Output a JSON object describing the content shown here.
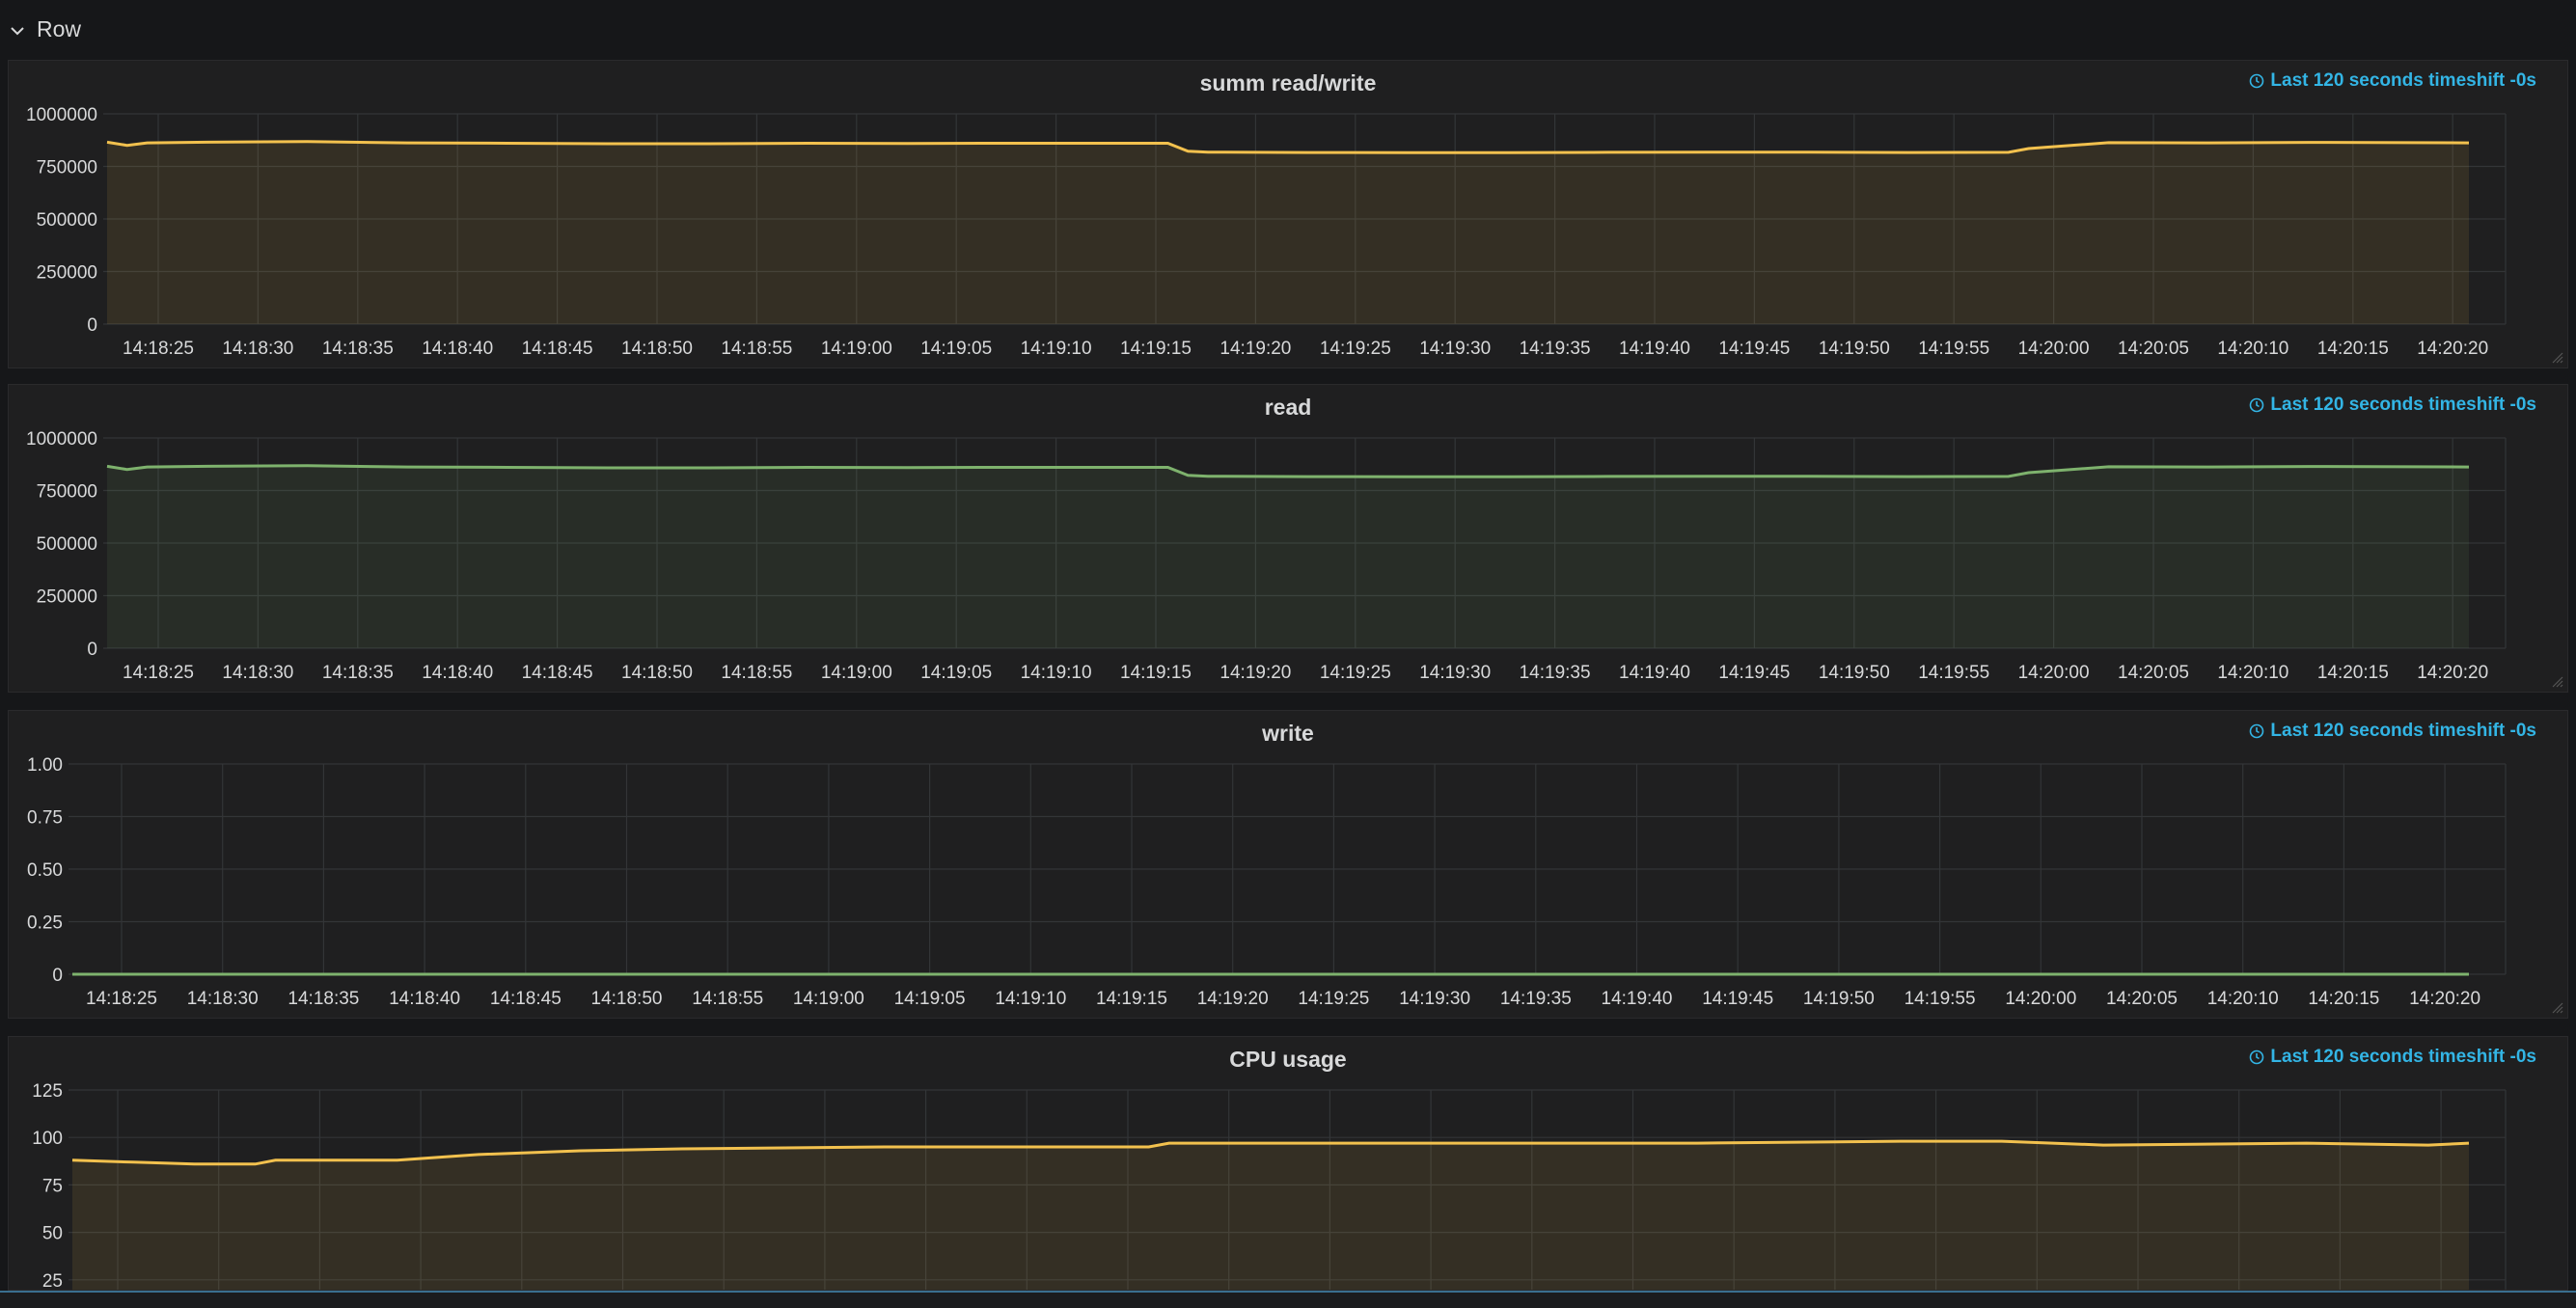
{
  "row": {
    "title": "Row"
  },
  "time_info": "Last 120 seconds timeshift -0s",
  "panels": [
    {
      "title": "summ read/write"
    },
    {
      "title": "read"
    },
    {
      "title": "write"
    },
    {
      "title": "CPU usage"
    }
  ],
  "colors": {
    "background": "#161719",
    "panel": "#1f1f20",
    "grid": "#333537",
    "axis_text": "#d8d9da",
    "accent": "#33b5e5",
    "series_yellow": "#f2c14e",
    "series_green": "#7eb26d"
  },
  "chart_data": [
    {
      "type": "area",
      "title": "summ read/write",
      "y_ticks": [
        "0",
        "250000",
        "500000",
        "750000",
        "1000000"
      ],
      "ylim": [
        0,
        1000000
      ],
      "x_ticks": [
        "14:18:25",
        "14:18:30",
        "14:18:35",
        "14:18:40",
        "14:18:45",
        "14:18:50",
        "14:18:55",
        "14:19:00",
        "14:19:05",
        "14:19:10",
        "14:19:15",
        "14:19:20",
        "14:19:25",
        "14:19:30",
        "14:19:35",
        "14:19:40",
        "14:19:45",
        "14:19:50",
        "14:19:55",
        "14:20:00",
        "14:20:05",
        "14:20:10",
        "14:20:15",
        "14:20:20"
      ],
      "grid": true,
      "series": [
        {
          "color": "#f2c14e",
          "fill": true,
          "x": [
            0,
            1,
            2,
            5,
            10,
            15,
            20,
            25,
            30,
            35,
            40,
            45,
            50,
            53,
            54,
            55,
            60,
            65,
            70,
            75,
            80,
            85,
            90,
            95,
            96,
            100,
            105,
            110,
            115,
            118
          ],
          "values": [
            865000,
            850000,
            862000,
            865000,
            868000,
            862000,
            860000,
            858000,
            858000,
            860000,
            859000,
            860000,
            860000,
            860000,
            822000,
            818000,
            816000,
            815000,
            815000,
            817000,
            818000,
            818000,
            816000,
            817000,
            835000,
            863000,
            862000,
            864000,
            863000,
            862000
          ]
        }
      ]
    },
    {
      "type": "area",
      "title": "read",
      "y_ticks": [
        "0",
        "250000",
        "500000",
        "750000",
        "1000000"
      ],
      "ylim": [
        0,
        1000000
      ],
      "x_ticks": [
        "14:18:25",
        "14:18:30",
        "14:18:35",
        "14:18:40",
        "14:18:45",
        "14:18:50",
        "14:18:55",
        "14:19:00",
        "14:19:05",
        "14:19:10",
        "14:19:15",
        "14:19:20",
        "14:19:25",
        "14:19:30",
        "14:19:35",
        "14:19:40",
        "14:19:45",
        "14:19:50",
        "14:19:55",
        "14:20:00",
        "14:20:05",
        "14:20:10",
        "14:20:15",
        "14:20:20"
      ],
      "grid": true,
      "series": [
        {
          "color": "#7eb26d",
          "fill": true,
          "x": [
            0,
            1,
            2,
            5,
            10,
            15,
            20,
            25,
            30,
            35,
            40,
            45,
            50,
            53,
            54,
            55,
            60,
            65,
            70,
            75,
            80,
            85,
            90,
            95,
            96,
            100,
            105,
            110,
            115,
            118
          ],
          "values": [
            865000,
            850000,
            862000,
            865000,
            868000,
            862000,
            860000,
            858000,
            858000,
            860000,
            859000,
            860000,
            860000,
            860000,
            822000,
            818000,
            816000,
            815000,
            815000,
            817000,
            818000,
            818000,
            816000,
            817000,
            835000,
            863000,
            862000,
            864000,
            863000,
            862000
          ]
        }
      ]
    },
    {
      "type": "line",
      "title": "write",
      "y_ticks": [
        "0",
        "0.25",
        "0.50",
        "0.75",
        "1.00"
      ],
      "ylim": [
        0,
        1
      ],
      "x_ticks": [
        "14:18:25",
        "14:18:30",
        "14:18:35",
        "14:18:40",
        "14:18:45",
        "14:18:50",
        "14:18:55",
        "14:19:00",
        "14:19:05",
        "14:19:10",
        "14:19:15",
        "14:19:20",
        "14:19:25",
        "14:19:30",
        "14:19:35",
        "14:19:40",
        "14:19:45",
        "14:19:50",
        "14:19:55",
        "14:20:00",
        "14:20:05",
        "14:20:10",
        "14:20:15",
        "14:20:20"
      ],
      "grid": true,
      "series": [
        {
          "color": "#7eb26d",
          "fill": false,
          "x": [
            0,
            118
          ],
          "values": [
            0,
            0
          ]
        }
      ]
    },
    {
      "type": "area",
      "title": "CPU usage",
      "y_ticks": [
        "25",
        "50",
        "75",
        "100",
        "125"
      ],
      "ylim": [
        0,
        125
      ],
      "x_ticks": [],
      "grid": true,
      "series": [
        {
          "color": "#f2c14e",
          "fill": true,
          "x": [
            0,
            3,
            6,
            9,
            10,
            12,
            14,
            16,
            20,
            25,
            30,
            40,
            50,
            53,
            54,
            60,
            70,
            80,
            90,
            95,
            100,
            110,
            116,
            118
          ],
          "values": [
            88,
            87,
            86,
            86,
            88,
            88,
            88,
            88,
            91,
            93,
            94,
            95,
            95,
            95,
            97,
            97,
            97,
            97,
            98,
            98,
            96,
            97,
            96,
            97
          ]
        }
      ]
    }
  ]
}
